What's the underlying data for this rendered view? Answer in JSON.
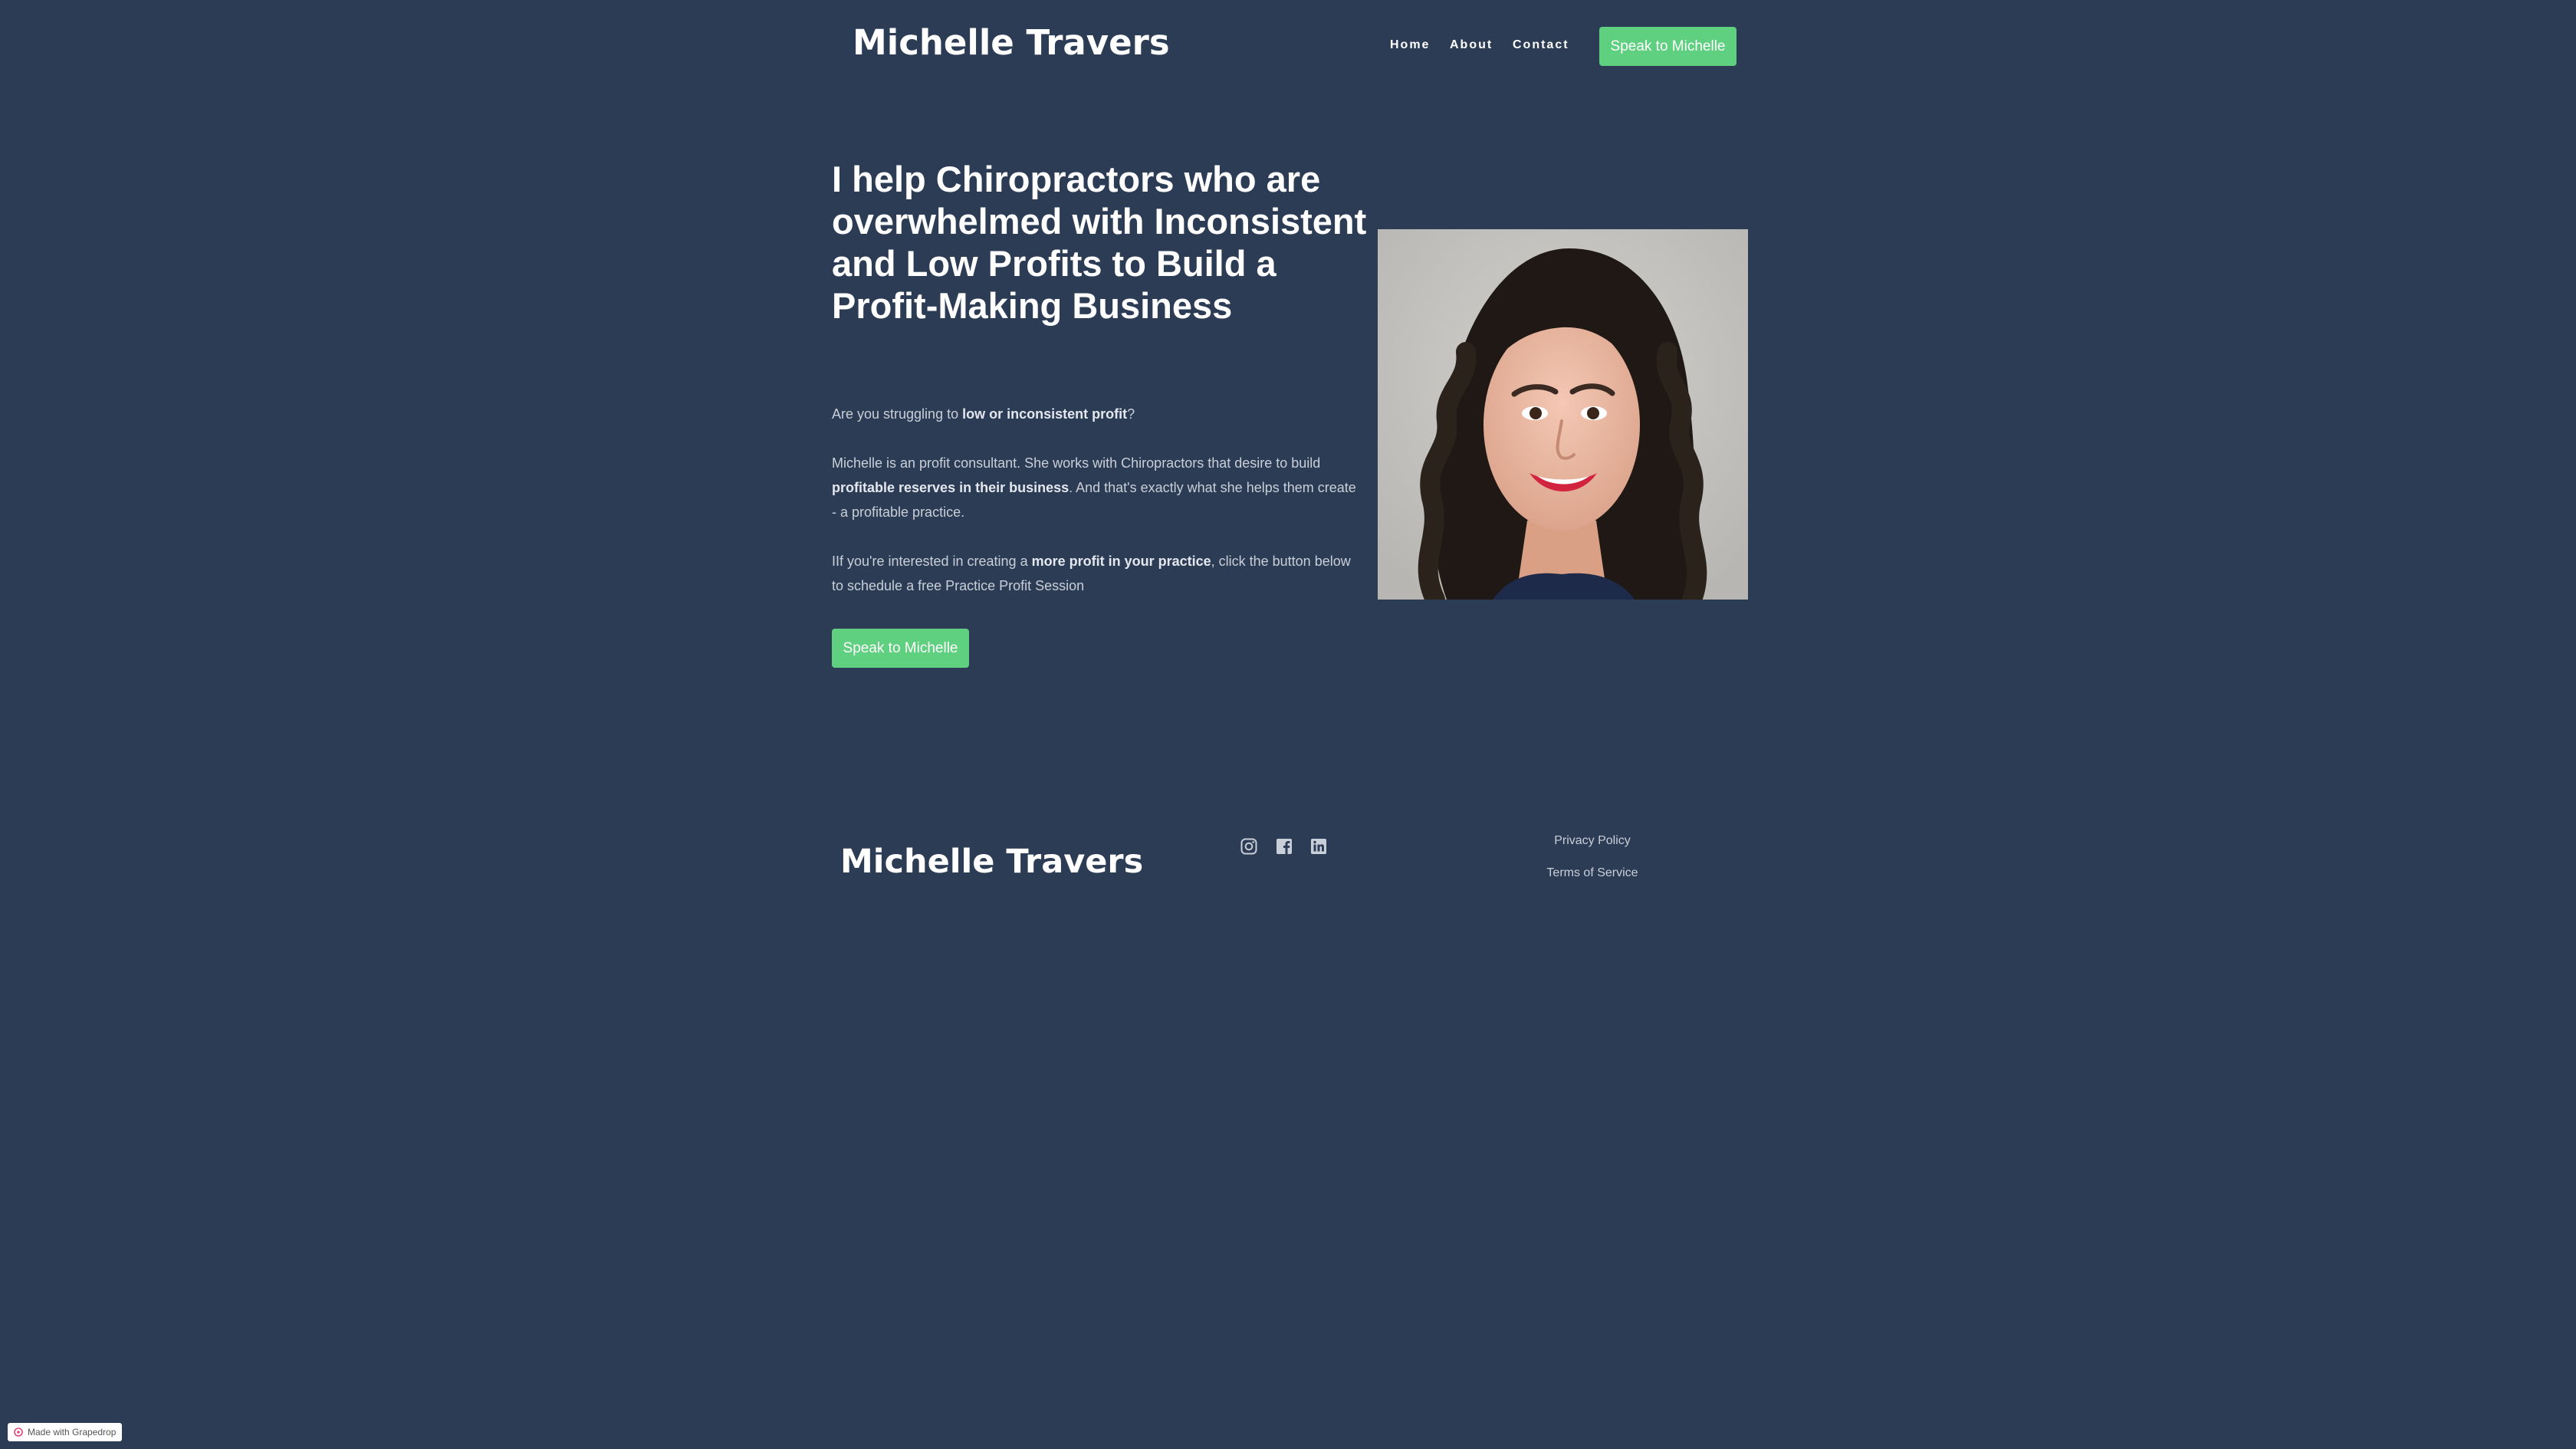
{
  "header": {
    "brand": "Michelle Travers",
    "nav": [
      {
        "label": "Home"
      },
      {
        "label": "About"
      },
      {
        "label": "Contact"
      }
    ],
    "cta_label": "Speak to Michelle"
  },
  "hero": {
    "title": "I help Chiropractors who are overwhelmed with Inconsistent and Low Profits to Build a Profit-Making Business",
    "p1": {
      "before": "Are you struggling to ",
      "bold": "low or inconsistent profit",
      "after": "?"
    },
    "p2": {
      "before": "Michelle is an profit consultant. She works with Chiropractors that desire to build ",
      "bold": "profitable reserves in their business",
      "after": ". And that's exactly what she helps them create - a profitable practice."
    },
    "p3": {
      "before": "IIf you're interested in creating a ",
      "bold": "more profit in your practice",
      "after": ", click the button below to schedule a free Practice Profit Session"
    },
    "cta_label": "Speak to Michelle",
    "portrait_icon": "portrait-photo"
  },
  "footer": {
    "brand": "Michelle Travers",
    "social": [
      {
        "icon": "instagram-icon"
      },
      {
        "icon": "facebook-icon"
      },
      {
        "icon": "linkedin-icon"
      }
    ],
    "links": [
      {
        "label": "Privacy Policy"
      },
      {
        "label": "Terms of Service"
      }
    ]
  },
  "badge": {
    "label": "Made with Grapedrop"
  },
  "colors": {
    "background": "#2d3c55",
    "accent": "#5fcf80",
    "text": "#ffffff",
    "muted_text": "#c9cfd9"
  }
}
